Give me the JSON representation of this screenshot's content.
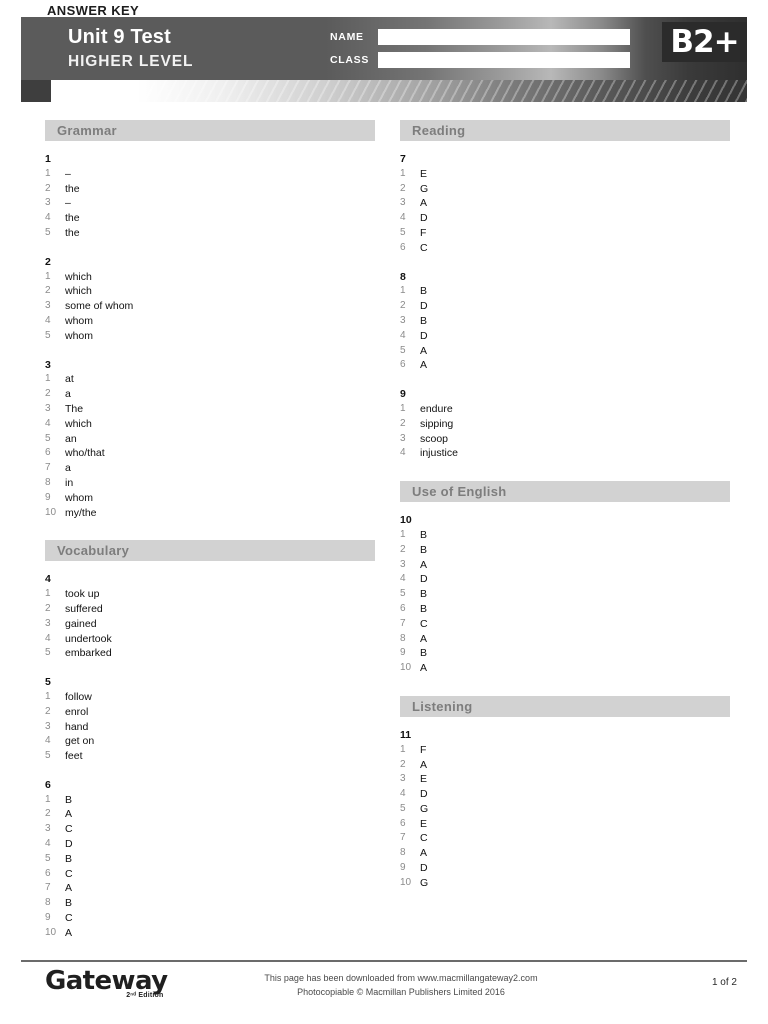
{
  "header": {
    "title": "Unit 9 Test",
    "subtitle": "HIGHER LEVEL",
    "answer_key_label": "ANSWER KEY",
    "level_badge": "B2+",
    "name_label": "NAME",
    "class_label": "CLASS",
    "name_value": "",
    "class_value": "",
    "name_placeholder": "",
    "class_placeholder": "",
    "colors": {
      "header_dark": "#5b5b5b",
      "badge_bg": "#2b2b2b",
      "section_head_bg": "#d2d2d2",
      "section_head_text": "#7d7d7d"
    }
  },
  "left_column": {
    "sections": [
      {
        "title": "Grammar",
        "exercises": [
          {
            "number": "1",
            "answers": [
              {
                "idx": "1",
                "value": "–"
              },
              {
                "idx": "2",
                "value": "the"
              },
              {
                "idx": "3",
                "value": "–"
              },
              {
                "idx": "4",
                "value": "the"
              },
              {
                "idx": "5",
                "value": "the"
              }
            ]
          },
          {
            "number": "2",
            "answers": [
              {
                "idx": "1",
                "value": "which"
              },
              {
                "idx": "2",
                "value": "which"
              },
              {
                "idx": "3",
                "value": "some of whom"
              },
              {
                "idx": "4",
                "value": "whom"
              },
              {
                "idx": "5",
                "value": "whom"
              }
            ]
          },
          {
            "number": "3",
            "answers": [
              {
                "idx": "1",
                "value": "at"
              },
              {
                "idx": "2",
                "value": "a"
              },
              {
                "idx": "3",
                "value": "The"
              },
              {
                "idx": "4",
                "value": "which"
              },
              {
                "idx": "5",
                "value": "an"
              },
              {
                "idx": "6",
                "value": "who/that"
              },
              {
                "idx": "7",
                "value": "a"
              },
              {
                "idx": "8",
                "value": "in"
              },
              {
                "idx": "9",
                "value": "whom"
              },
              {
                "idx": "10",
                "value": "my/the"
              }
            ]
          }
        ]
      },
      {
        "title": "Vocabulary",
        "exercises": [
          {
            "number": "4",
            "answers": [
              {
                "idx": "1",
                "value": "took up"
              },
              {
                "idx": "2",
                "value": "suffered"
              },
              {
                "idx": "3",
                "value": "gained"
              },
              {
                "idx": "4",
                "value": "undertook"
              },
              {
                "idx": "5",
                "value": "embarked"
              }
            ]
          },
          {
            "number": "5",
            "answers": [
              {
                "idx": "1",
                "value": "follow"
              },
              {
                "idx": "2",
                "value": "enrol"
              },
              {
                "idx": "3",
                "value": "hand"
              },
              {
                "idx": "4",
                "value": "get on"
              },
              {
                "idx": "5",
                "value": "feet"
              }
            ]
          },
          {
            "number": "6",
            "answers": [
              {
                "idx": "1",
                "value": "B"
              },
              {
                "idx": "2",
                "value": "A"
              },
              {
                "idx": "3",
                "value": "C"
              },
              {
                "idx": "4",
                "value": "D"
              },
              {
                "idx": "5",
                "value": "B"
              },
              {
                "idx": "6",
                "value": "C"
              },
              {
                "idx": "7",
                "value": "A"
              },
              {
                "idx": "8",
                "value": "B"
              },
              {
                "idx": "9",
                "value": "C"
              },
              {
                "idx": "10",
                "value": "A"
              }
            ]
          }
        ]
      }
    ]
  },
  "right_column": {
    "sections": [
      {
        "title": "Reading",
        "exercises": [
          {
            "number": "7",
            "answers": [
              {
                "idx": "1",
                "value": "E"
              },
              {
                "idx": "2",
                "value": "G"
              },
              {
                "idx": "3",
                "value": "A"
              },
              {
                "idx": "4",
                "value": "D"
              },
              {
                "idx": "5",
                "value": "F"
              },
              {
                "idx": "6",
                "value": "C"
              }
            ]
          },
          {
            "number": "8",
            "answers": [
              {
                "idx": "1",
                "value": "B"
              },
              {
                "idx": "2",
                "value": "D"
              },
              {
                "idx": "3",
                "value": "B"
              },
              {
                "idx": "4",
                "value": "D"
              },
              {
                "idx": "5",
                "value": "A"
              },
              {
                "idx": "6",
                "value": "A"
              }
            ]
          },
          {
            "number": "9",
            "answers": [
              {
                "idx": "1",
                "value": "endure"
              },
              {
                "idx": "2",
                "value": "sipping"
              },
              {
                "idx": "3",
                "value": "scoop"
              },
              {
                "idx": "4",
                "value": "injustice"
              }
            ]
          }
        ]
      },
      {
        "title": "Use of English",
        "exercises": [
          {
            "number": "10",
            "answers": [
              {
                "idx": "1",
                "value": "B"
              },
              {
                "idx": "2",
                "value": "B"
              },
              {
                "idx": "3",
                "value": "A"
              },
              {
                "idx": "4",
                "value": "D"
              },
              {
                "idx": "5",
                "value": "B"
              },
              {
                "idx": "6",
                "value": "B"
              },
              {
                "idx": "7",
                "value": "C"
              },
              {
                "idx": "8",
                "value": "A"
              },
              {
                "idx": "9",
                "value": "B"
              },
              {
                "idx": "10",
                "value": "A"
              }
            ]
          }
        ]
      },
      {
        "title": "Listening",
        "exercises": [
          {
            "number": "11",
            "answers": [
              {
                "idx": "1",
                "value": "F"
              },
              {
                "idx": "2",
                "value": "A"
              },
              {
                "idx": "3",
                "value": "E"
              },
              {
                "idx": "4",
                "value": "D"
              },
              {
                "idx": "5",
                "value": "G"
              },
              {
                "idx": "6",
                "value": "E"
              },
              {
                "idx": "7",
                "value": "C"
              },
              {
                "idx": "8",
                "value": "A"
              },
              {
                "idx": "9",
                "value": "D"
              },
              {
                "idx": "10",
                "value": "G"
              }
            ]
          }
        ]
      }
    ]
  },
  "footer": {
    "logo_main": "Gateway",
    "logo_sub": "2ⁿᵈ Edition",
    "line1": "This page has been downloaded from www.macmillangateway2.com",
    "line2": "Photocopiable © Macmillan Publishers Limited 2016",
    "page_indicator": "1 of 2"
  }
}
